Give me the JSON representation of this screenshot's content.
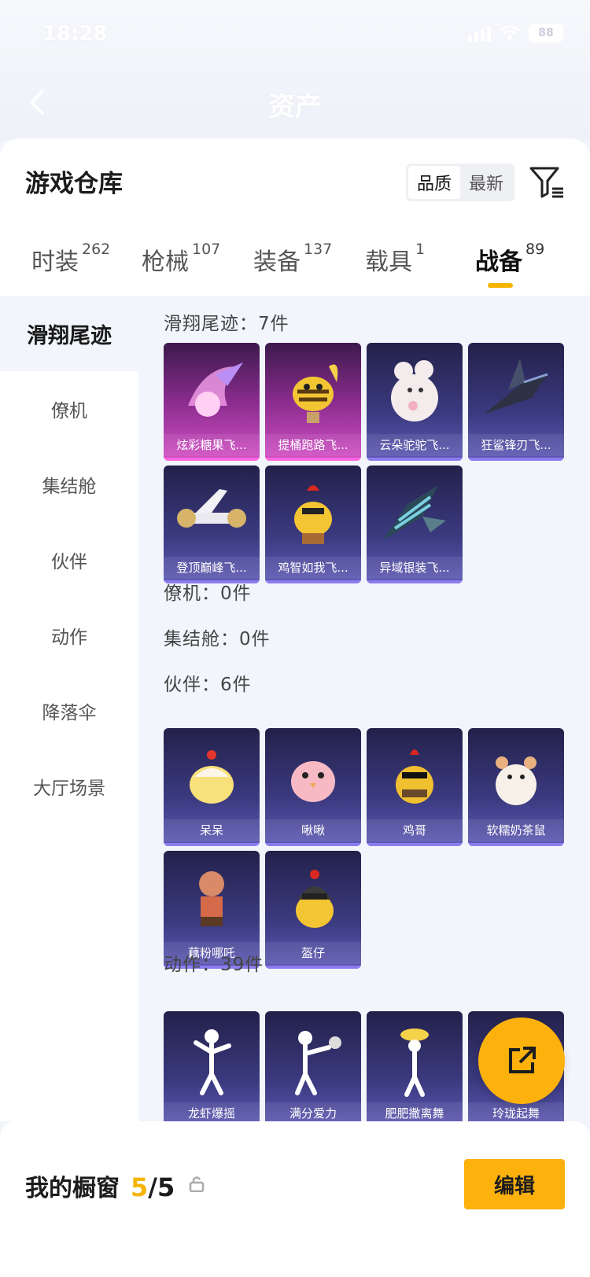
{
  "status": {
    "time": "18:28",
    "battery": "88"
  },
  "nav": {
    "title": "资产"
  },
  "warehouse": {
    "title": "游戏仓库"
  },
  "sort": {
    "options": [
      "品质",
      "最新"
    ],
    "active": "品质"
  },
  "tabs": [
    {
      "label": "时装",
      "count": "262"
    },
    {
      "label": "枪械",
      "count": "107"
    },
    {
      "label": "装备",
      "count": "137"
    },
    {
      "label": "载具",
      "count": "1"
    },
    {
      "label": "战备",
      "count": "89"
    }
  ],
  "active_tab": "战备",
  "sidebar": {
    "items": [
      "滑翔尾迹",
      "僚机",
      "集结舱",
      "伙伴",
      "动作",
      "降落伞",
      "大厅场景"
    ],
    "active": "滑翔尾迹"
  },
  "sections": {
    "glide": {
      "title": "滑翔尾迹：7件",
      "items": [
        "炫彩糖果飞...",
        "提桶跑路飞...",
        "云朵驼驼飞...",
        "狂鲨锋刃飞...",
        "登顶巅峰飞...",
        "鸡智如我飞...",
        "异域银装飞..."
      ]
    },
    "wingman": {
      "title": "僚机：0件"
    },
    "pod": {
      "title": "集结舱：0件"
    },
    "partner": {
      "title": "伙伴：6件",
      "items": [
        "呆呆",
        "啾啾",
        "鸡哥",
        "软糯奶茶鼠",
        "藕粉哪吒",
        "盔仔"
      ]
    },
    "emote": {
      "title": "动作：39件",
      "items": [
        "龙虾爆摇",
        "满分爱力",
        "肥肥撒离舞",
        "玲珑起舞"
      ]
    }
  },
  "showcase": {
    "label": "我的橱窗",
    "count": "5",
    "total": "/5"
  },
  "edit_label": "编辑",
  "colors": {
    "accent": "#fdb10d",
    "card_dark": "#2e2c66",
    "card_pink": "#b33fb4"
  }
}
